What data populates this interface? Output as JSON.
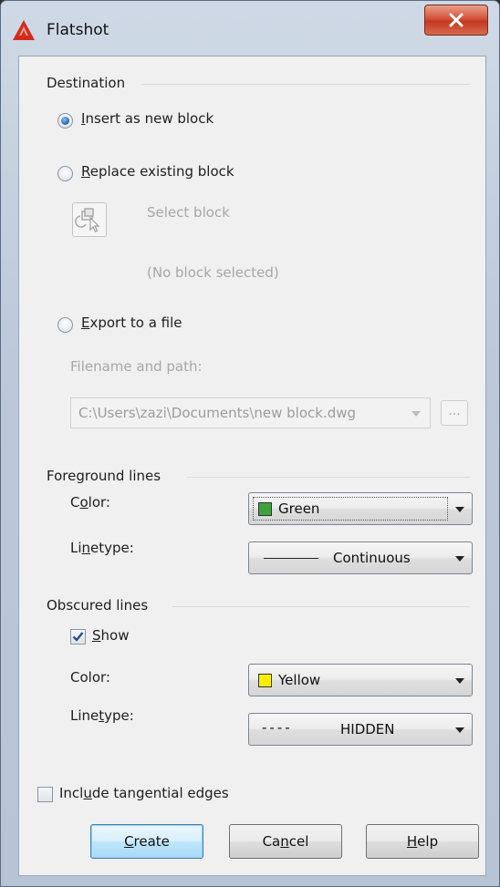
{
  "window": {
    "title": "Flatshot"
  },
  "destination": {
    "heading": "Destination",
    "insert_label_prefix": "",
    "insert_label_mnemonic": "I",
    "insert_label_rest": "nsert as new block",
    "replace_label_mnemonic": "R",
    "replace_label_rest": "eplace existing block",
    "select_block_label": "Select block",
    "no_block_text": "(No block selected)",
    "export_label_mnemonic": "E",
    "export_label_rest": "xport to a file",
    "filename_label": "Filename and path:",
    "filename_value": "C:\\Users\\zazi\\Documents\\new block.dwg",
    "browse_label": "..."
  },
  "foreground": {
    "heading": "Foreground lines",
    "color_label_pre": "C",
    "color_label_mnemonic": "o",
    "color_label_post": "lor:",
    "color_value": "Green",
    "color_swatch": "#3ca33c",
    "linetype_label_pre": "Li",
    "linetype_label_mnemonic": "n",
    "linetype_label_post": "etype:",
    "linetype_value": "Continuous"
  },
  "obscured": {
    "heading": "Obscured lines",
    "show_label_mnemonic": "S",
    "show_label_rest": "how",
    "color_label": "Color:",
    "color_value": "Yellow",
    "color_swatch": "#ffee00",
    "linetype_label_pre": "Line",
    "linetype_label_mnemonic": "t",
    "linetype_label_post": "ype:",
    "linetype_value": "HIDDEN",
    "linetype_dashes": "----"
  },
  "tangential": {
    "label_pre": "Incl",
    "label_mnemonic": "u",
    "label_post": "de tangential edges"
  },
  "buttons": {
    "create_mnemonic": "C",
    "create_rest": "reate",
    "cancel_pre": "Ca",
    "cancel_mnemonic": "n",
    "cancel_post": "cel",
    "help_mnemonic": "H",
    "help_rest": "elp"
  },
  "colors": {
    "accent": "#3c7fb1",
    "close_button": "#c23a20"
  }
}
